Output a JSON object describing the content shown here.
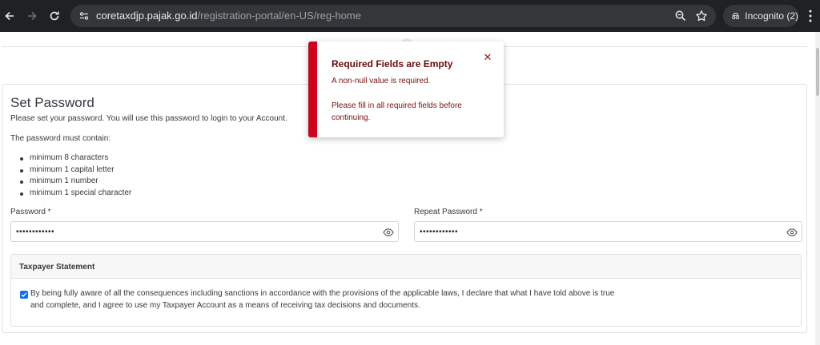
{
  "browser": {
    "url_host": "coretaxdjp.pajak.go.id",
    "url_path": "/registration-portal/en-US/reg-home",
    "incognito_label": "Incognito (2)"
  },
  "form": {
    "title": "Set Password",
    "description": "Please set your password. You will use this password to login to your Account.",
    "requirements_intro": "The password must contain:",
    "requirements": [
      "minimum 8 characters",
      "minimum 1 capital letter",
      "minimum 1 number",
      "minimum 1 special character"
    ],
    "password_label": "Password *",
    "password_value": "••••••••••••",
    "repeat_password_label": "Repeat Password *",
    "repeat_password_value": "••••••••••••"
  },
  "statement": {
    "title": "Taxpayer Statement",
    "checked": true,
    "text": "By being fully aware of all the consequences including sanctions in accordance with the provisions of the applicable laws, I declare that what I have told above is true and complete, and I agree to use my Taxpayer Account as a means of receiving tax decisions and documents."
  },
  "toast": {
    "title": "Required Fields are Empty",
    "message1": "A non-null value is required.",
    "message2": "Please fill in all required fields before continuing.",
    "close_glyph": "✕"
  },
  "colors": {
    "toast_accent": "#d0021b",
    "checkbox": "#0d6efd"
  },
  "icons": [
    "back-arrow-icon",
    "forward-arrow-icon",
    "reload-icon",
    "site-info-icon",
    "zoom-icon",
    "bookmark-star-icon",
    "incognito-icon",
    "menu-dots-icon",
    "eye-icon",
    "checkbox-check-icon",
    "close-icon"
  ]
}
